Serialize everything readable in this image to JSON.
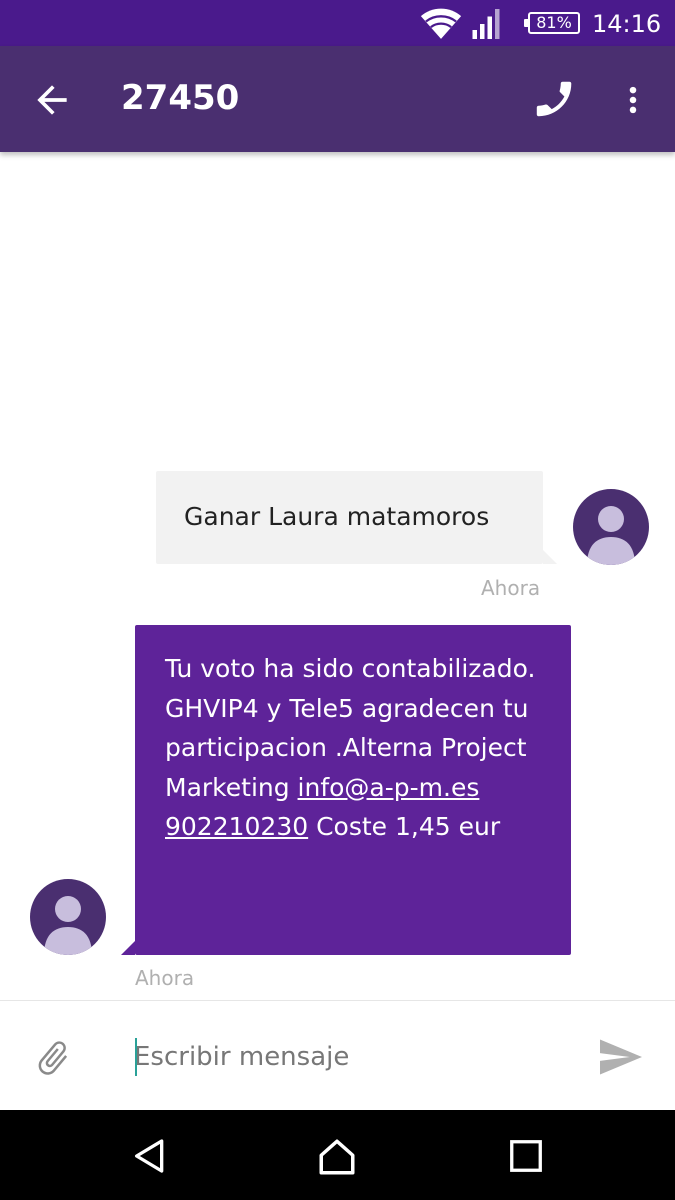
{
  "status_bar": {
    "battery": "81%",
    "time": "14:16",
    "icons": [
      "wifi-icon",
      "signal-icon",
      "battery-icon"
    ]
  },
  "app_bar": {
    "title": "27450",
    "icons": [
      "back-arrow-icon",
      "phone-icon",
      "more-vert-icon"
    ]
  },
  "messages": [
    {
      "direction": "outgoing",
      "text": "Ganar Laura matamoros",
      "time": "Ahora"
    },
    {
      "direction": "incoming",
      "text_before": "Tu voto ha sido contabilizado. GHVIP4 y Tele5 agradecen tu participacion .Alterna Project Marketing ",
      "link_email": "info@a-p-m.es",
      "link_phone": "902210230",
      "text_after": " Coste 1,45 eur",
      "time": "Ahora"
    }
  ],
  "compose": {
    "placeholder": "Escribir mensaje",
    "icons": [
      "attach-icon",
      "send-icon"
    ]
  },
  "nav_bar": {
    "icons": [
      "nav-back-icon",
      "nav-home-icon",
      "nav-recents-icon"
    ]
  },
  "colors": {
    "status_bar": "#4a1a8c",
    "app_bar": "#4a2f70",
    "incoming_bubble": "#5e2399",
    "outgoing_bubble": "#f2f2f2",
    "avatar": "#4a2f70",
    "cursor": "#2aa198"
  }
}
